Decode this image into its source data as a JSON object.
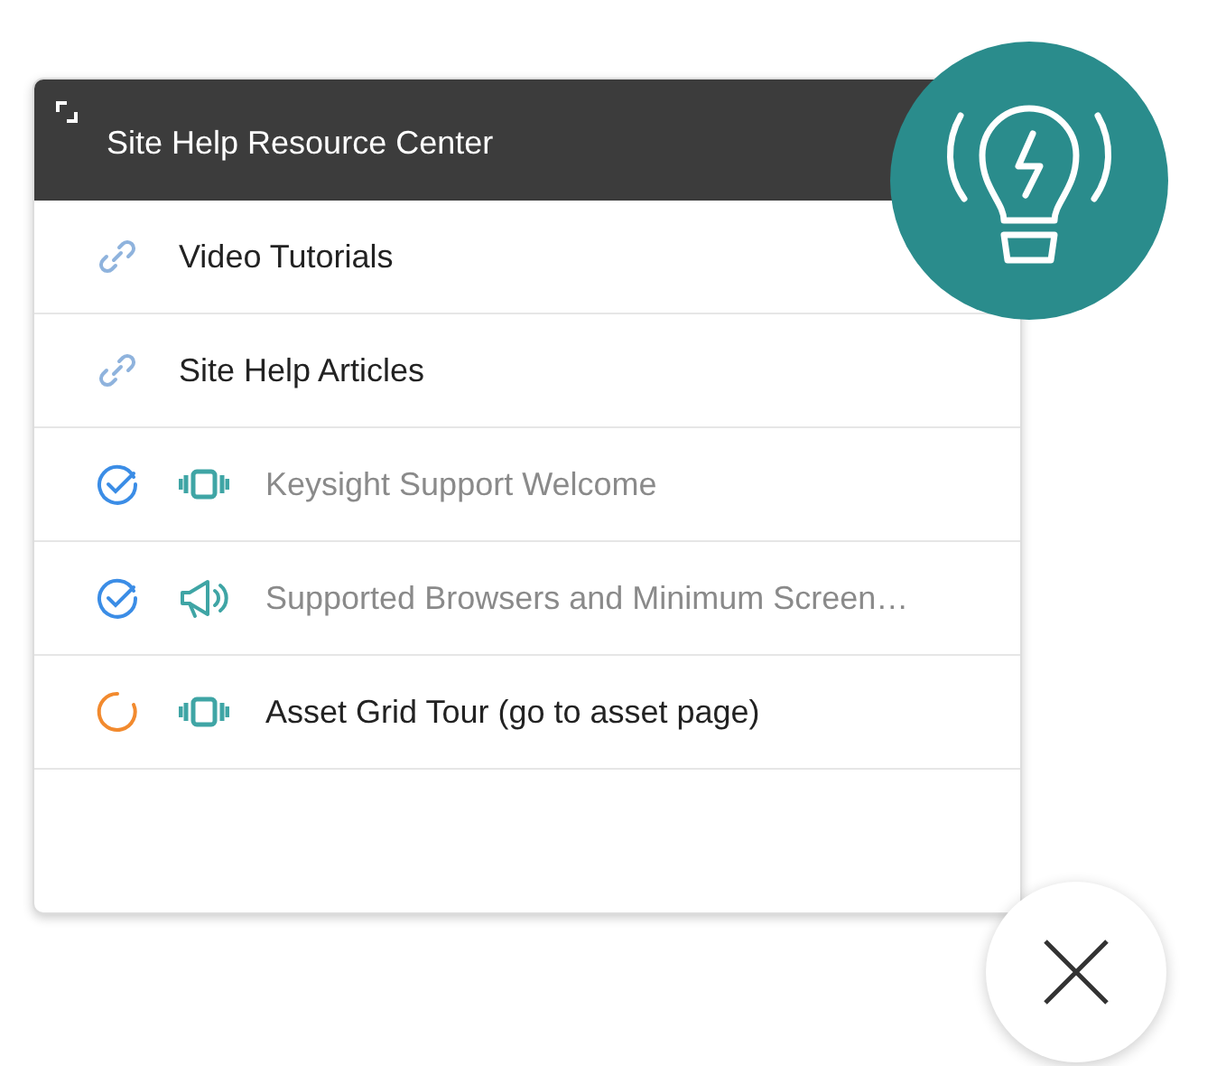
{
  "panel": {
    "title": "Site Help Resource Center"
  },
  "items": [
    {
      "kind": "link",
      "label": "Video Tutorials"
    },
    {
      "kind": "link",
      "label": "Site Help Articles"
    },
    {
      "kind": "tour",
      "completed": true,
      "label": "Keysight Support Welcome"
    },
    {
      "kind": "announcement",
      "completed": true,
      "label": "Supported Browsers and Minimum Screen…"
    },
    {
      "kind": "tour",
      "completed": false,
      "label": "Asset Grid Tour (go to asset page)"
    }
  ]
}
